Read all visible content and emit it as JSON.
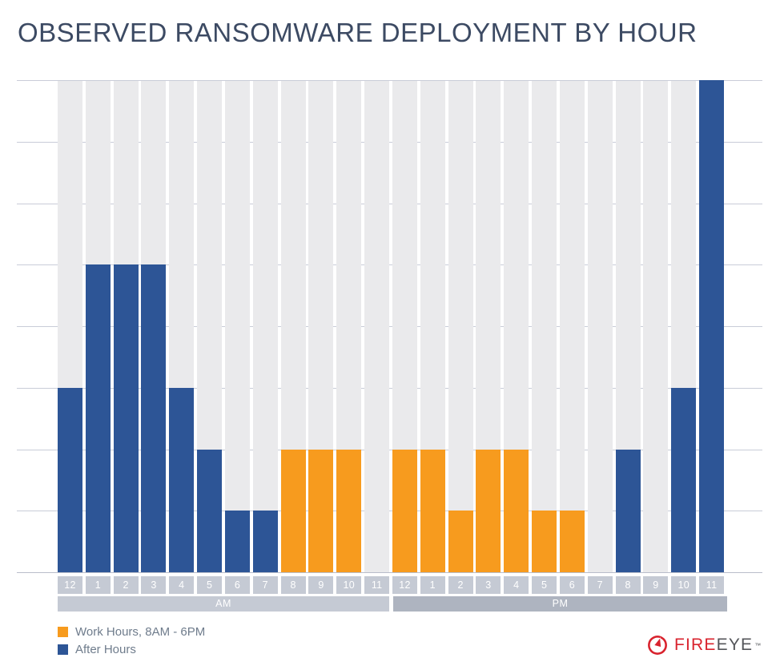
{
  "title": "OBSERVED RANSOMWARE DEPLOYMENT BY HOUR",
  "legend": {
    "items": [
      {
        "label": "Work Hours, 8AM - 6PM",
        "color": "#f79b1e",
        "swatch": "work-hours-swatch"
      },
      {
        "label": "After Hours",
        "color": "#2d5596",
        "swatch": "after-hours-swatch"
      }
    ]
  },
  "axis": {
    "meridiem": [
      {
        "label": "AM",
        "color": "#c5cad4"
      },
      {
        "label": "PM",
        "color": "#aeb4c0"
      }
    ],
    "hour_labels": [
      "12",
      "1",
      "2",
      "3",
      "4",
      "5",
      "6",
      "7",
      "8",
      "9",
      "10",
      "11",
      "12",
      "1",
      "2",
      "3",
      "4",
      "5",
      "6",
      "7",
      "8",
      "9",
      "10",
      "11"
    ]
  },
  "brand": {
    "mark": "fireeye-logo-icon",
    "name_primary": "FIRE",
    "name_secondary": "EYE",
    "trademark": "™"
  },
  "colors": {
    "work_hours": "#f79b1e",
    "after_hours": "#2d5596",
    "column_band": "#eaeaec",
    "gridline": "#c9ccd8",
    "chip": "#c5cad4",
    "title": "#3c4a63",
    "legend_text": "#6f7c8c"
  },
  "chart_data": {
    "type": "bar",
    "title": "OBSERVED RANSOMWARE DEPLOYMENT BY HOUR",
    "xlabel": "",
    "ylabel": "",
    "ylim": [
      0,
      8
    ],
    "grid": true,
    "gridline_count": 8,
    "legend_position": "bottom-left",
    "categories": [
      "12 AM",
      "1 AM",
      "2 AM",
      "3 AM",
      "4 AM",
      "5 AM",
      "6 AM",
      "7 AM",
      "8 AM",
      "9 AM",
      "10 AM",
      "11 AM",
      "12 PM",
      "1 PM",
      "2 PM",
      "3 PM",
      "4 PM",
      "5 PM",
      "6 PM",
      "7 PM",
      "8 PM",
      "9 PM",
      "10 PM",
      "11 PM"
    ],
    "values": [
      3,
      5,
      5,
      5,
      3,
      2,
      1,
      1,
      2,
      2,
      2,
      0,
      2,
      2,
      1,
      2,
      2,
      1,
      1,
      0,
      2,
      0,
      3,
      8
    ],
    "bar_categories": [
      "after",
      "after",
      "after",
      "after",
      "after",
      "after",
      "after",
      "after",
      "work",
      "work",
      "work",
      "work",
      "work",
      "work",
      "work",
      "work",
      "work",
      "work",
      "work",
      "after",
      "after",
      "after",
      "after",
      "after"
    ],
    "series": [
      {
        "name": "Work Hours, 8AM - 6PM",
        "color": "#f79b1e"
      },
      {
        "name": "After Hours",
        "color": "#2d5596"
      }
    ]
  }
}
